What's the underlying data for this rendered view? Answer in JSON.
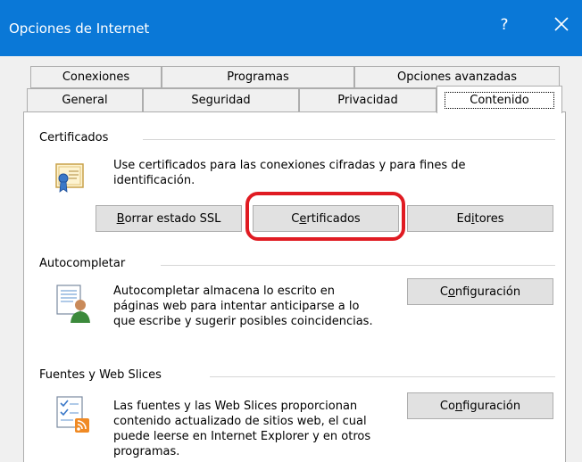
{
  "window": {
    "title": "Opciones de Internet",
    "help_label": "?",
    "close_icon": "close-icon"
  },
  "tabs": {
    "row1": [
      {
        "label": "Conexiones"
      },
      {
        "label": "Programas"
      },
      {
        "label": "Opciones avanzadas"
      }
    ],
    "row2": [
      {
        "label": "General"
      },
      {
        "label": "Seguridad"
      },
      {
        "label": "Privacidad"
      },
      {
        "label": "Contenido",
        "active": true
      }
    ]
  },
  "certificados": {
    "group_label": "Certificados",
    "description": "Use certificados para las conexiones cifradas y para fines de identificación.",
    "icon": "certificate-icon",
    "buttons": {
      "borrar_ssl": {
        "label_before": "",
        "label_underlined": "B",
        "label_after": "orrar estado SSL"
      },
      "certificados": {
        "label_before": "C",
        "label_underlined": "e",
        "label_after": "rtificados"
      },
      "editores": {
        "label_before": "Ed",
        "label_underlined": "i",
        "label_after": "tores"
      }
    }
  },
  "autocompletar": {
    "group_label": "Autocompletar",
    "description": "Autocompletar almacena lo escrito en páginas web para intentar anticiparse a lo que escribe y sugerir posibles coincidencias.",
    "icon": "autocomplete-icon",
    "button": {
      "label_before": "C",
      "label_underlined": "o",
      "label_after": "nfiguración"
    }
  },
  "fuentes": {
    "group_label": "Fuentes y Web Slices",
    "description": "Las fuentes y las Web Slices proporcionan contenido actualizado de sitios web, el cual puede leerse en Internet Explorer y en otros programas.",
    "icon": "feeds-icon",
    "button": {
      "label_before": "Co",
      "label_underlined": "n",
      "label_after": "figuración"
    }
  },
  "colors": {
    "titlebar": "#0a78d7",
    "highlight": "#e01b22",
    "button_face": "#e1e1e1"
  }
}
